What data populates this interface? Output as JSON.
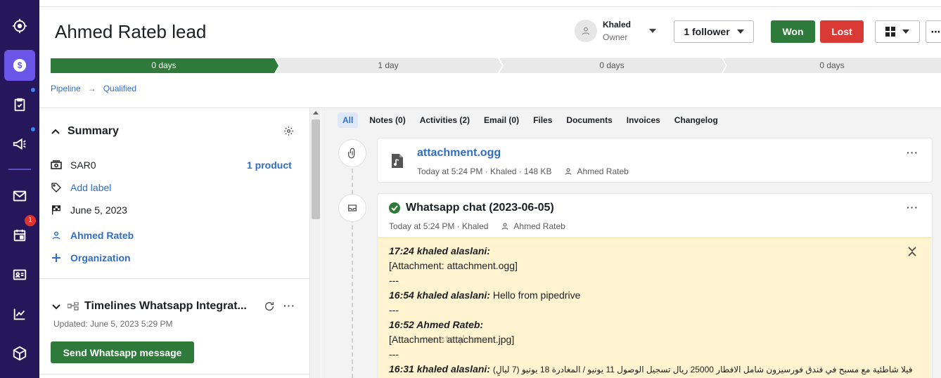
{
  "header": {
    "title": "Ahmed Rateb lead",
    "owner_name": "Khaled",
    "owner_role": "Owner",
    "follower_label": "1 follower",
    "won_label": "Won",
    "lost_label": "Lost"
  },
  "stages": [
    {
      "label": "0 days",
      "active": true
    },
    {
      "label": "1 day",
      "active": false
    },
    {
      "label": "0 days",
      "active": false
    },
    {
      "label": "0 days",
      "active": false
    }
  ],
  "breadcrumb": {
    "pipeline": "Pipeline",
    "stage": "Qualified"
  },
  "nav": {
    "calendar_badge": "1"
  },
  "summary": {
    "title": "Summary",
    "value": "SAR0",
    "product_link": "1 product",
    "add_label": "Add label",
    "date": "June 5, 2023",
    "person": "Ahmed Rateb",
    "organization": "Organization"
  },
  "whatsapp_panel": {
    "title": "Timelines Whatsapp Integrat...",
    "updated": "Updated: June 5, 2023 5:29 PM",
    "send_button": "Send Whatsapp message"
  },
  "tabs": [
    {
      "label": "All",
      "active": true
    },
    {
      "label": "Notes (0)",
      "active": false
    },
    {
      "label": "Activities (2)",
      "active": false
    },
    {
      "label": "Email (0)",
      "active": false
    },
    {
      "label": "Files",
      "active": false
    },
    {
      "label": "Documents",
      "active": false
    },
    {
      "label": "Invoices",
      "active": false
    },
    {
      "label": "Changelog",
      "active": false
    }
  ],
  "attachment_card": {
    "name": "attachment.ogg",
    "meta": "Today at 5:24 PM · Khaled · 148 KB",
    "person": "Ahmed Rateb"
  },
  "chat_card": {
    "title": "Whatsapp chat (2023-06-05)",
    "meta": "Today at 5:24 PM · Khaled",
    "person": "Ahmed Rateb",
    "lines": [
      {
        "prefix": "17:24 khaled alaslani:",
        "text": ""
      },
      {
        "prefix": "",
        "text": "[Attachment: attachment.ogg]"
      },
      {
        "prefix": "",
        "text": "---"
      },
      {
        "prefix": "16:54 khaled alaslani:",
        "text": " Hello from pipedrive"
      },
      {
        "prefix": "",
        "text": "---"
      },
      {
        "prefix": "16:52 Ahmed Rateb:",
        "text": ""
      },
      {
        "prefix": "",
        "text": "[Attachment: attachment.jpg]"
      },
      {
        "prefix": "",
        "text": "---"
      },
      {
        "prefix": "16:31 khaled alaslani:",
        "text": "فيلا شاطئية مع مسبح في فندق فورسيزون شامل الافطار 25000 ريال تسجيل الوصول 11 يونيو / المغادرة 18 يونيو (7 ليالٍ)"
      }
    ]
  },
  "watermark": "mostaql.com",
  "colors": {
    "nav_bg": "#26175a",
    "nav_active": "#6a55e8",
    "won": "#2d7a3a",
    "lost": "#d93a36",
    "link": "#2f6ec4",
    "stage_active": "#2d7a3a",
    "stage_inactive": "#e9e9e9",
    "chat_bg": "#fff4cf"
  }
}
